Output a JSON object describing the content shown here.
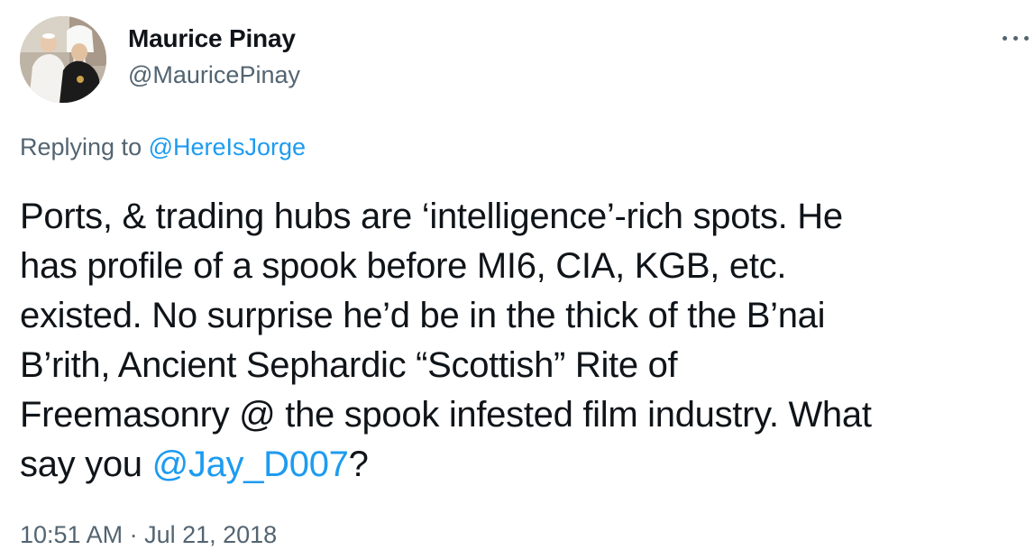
{
  "user": {
    "display_name": "Maurice Pinay",
    "handle": "@MauricePinay"
  },
  "reply": {
    "prefix": "Replying to ",
    "mention": "@HereIsJorge"
  },
  "tweet": {
    "lines": [
      "Ports, & trading hubs are ‘intelligence’-rich spots. He",
      "has profile of a spook before MI6, CIA, KGB, etc.",
      "existed. No surprise he’d be in the thick of the B’nai",
      "B’rith, Ancient Sephardic “Scottish” Rite of",
      "Freemasonry @ the spook infested film industry. What"
    ],
    "last_line_prefix": "say you ",
    "last_line_mention": "@Jay_D007",
    "last_line_suffix": "?"
  },
  "timestamp": {
    "time": "10:51 AM",
    "separator": " · ",
    "date": "Jul 21, 2018"
  },
  "icons": {
    "more": "more-options-icon",
    "avatar": "profile-avatar"
  },
  "colors": {
    "link": "#1d9bf0",
    "secondary_text": "#536471",
    "primary_text": "#0f1419"
  }
}
